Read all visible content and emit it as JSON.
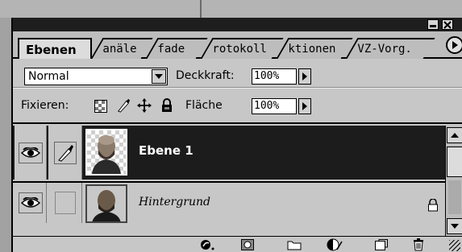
{
  "palette": {
    "tabs": [
      {
        "label": "Ebenen",
        "active": true
      },
      {
        "label": "anäle",
        "active": false
      },
      {
        "label": "fade",
        "active": false
      },
      {
        "label": "rotokoll",
        "active": false
      },
      {
        "label": "ktionen",
        "active": false
      },
      {
        "label": "VZ-Vorg.",
        "active": false
      }
    ],
    "tab_menu_icon": "triangle-right-icon"
  },
  "options": {
    "blend_mode": "Normal",
    "opacity_label": "Deckkraft:",
    "opacity_value": "100%",
    "lock_label": "Fixieren:",
    "fill_label": "Fläche",
    "fill_value": "100%",
    "lock_icons": [
      "lock-transparency-icon",
      "lock-image-icon",
      "lock-position-icon",
      "lock-all-icon"
    ]
  },
  "layers": [
    {
      "name": "Ebene 1",
      "selected": true,
      "visible": true,
      "linked_icon": "brush-icon",
      "thumbnail": "portrait-transparent-thumbnail"
    },
    {
      "name": "Hintergrund",
      "selected": false,
      "visible": true,
      "locked": true,
      "thumbnail": "portrait-thumbnail"
    }
  ],
  "bottom_toolbar": {
    "icons": [
      "layer-style-icon",
      "layer-mask-icon",
      "new-set-icon",
      "adjustment-layer-icon",
      "new-layer-icon",
      "trash-icon"
    ]
  },
  "colors": {
    "selected_layer_bg": "#1c1c1c",
    "panel_bg": "#c7c7c7",
    "titlebar_bg": "#1e1e1e"
  }
}
